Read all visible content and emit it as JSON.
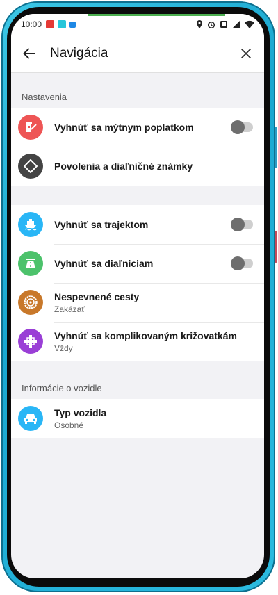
{
  "status": {
    "time": "10:00"
  },
  "appbar": {
    "title": "Navigácia"
  },
  "sections": {
    "settings_header": "Nastavenia",
    "vehicle_header": "Informácie o vozidle"
  },
  "settings": {
    "tolls": {
      "label": "Vyhnúť sa mýtnym poplatkom",
      "enabled": false
    },
    "permits": {
      "label": "Povolenia a diaľničné známky"
    }
  },
  "routing": {
    "ferries": {
      "label": "Vyhnúť sa trajektom",
      "enabled": false
    },
    "highways": {
      "label": "Vyhnúť sa diaľniciam",
      "enabled": false
    },
    "unpaved": {
      "label": "Nespevnené cesty",
      "value": "Zakázať"
    },
    "junctions": {
      "label": "Vyhnúť sa komplikovaným križovatkám",
      "value": "Vždy"
    }
  },
  "vehicle": {
    "type": {
      "label": "Typ vozidla",
      "value": "Osobné"
    }
  },
  "colors": {
    "toll": "#ee5555",
    "permit": "#444444",
    "ferry": "#29b6f6",
    "highway": "#4cc26b",
    "unpaved": "#c8782a",
    "junction": "#9a3fd6",
    "car": "#29b6f6"
  }
}
